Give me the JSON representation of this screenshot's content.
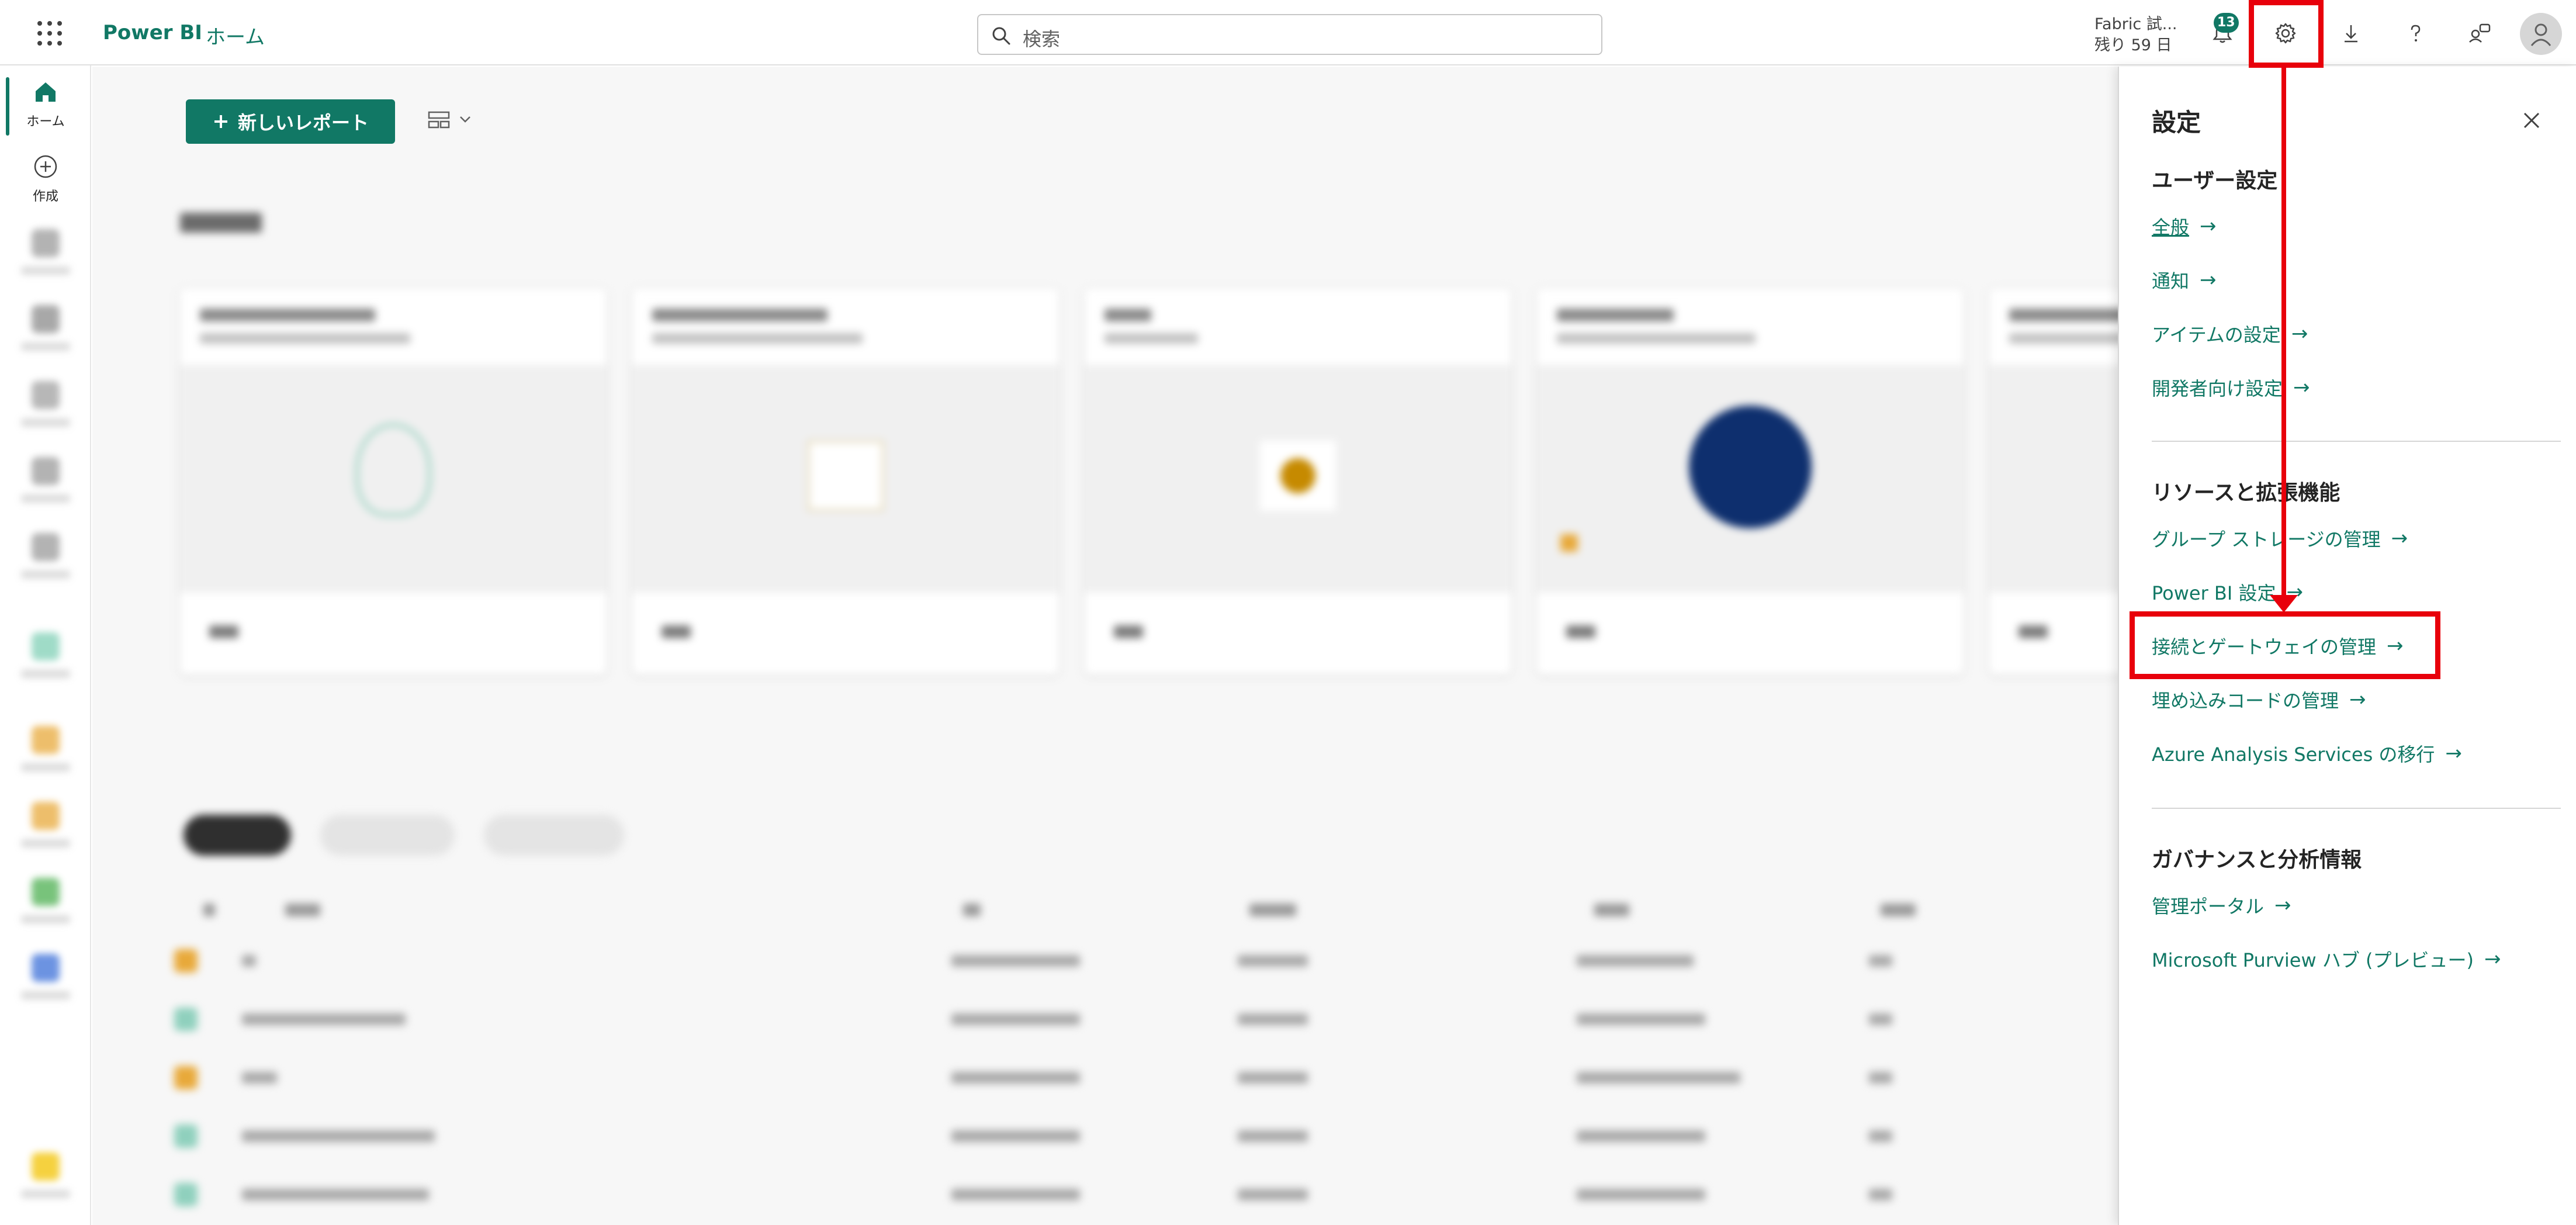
{
  "topbar": {
    "app_name": "Power BI",
    "breadcrumb": "ホーム",
    "search_placeholder": "検索",
    "trial_line1": "Fabric 試...",
    "trial_line2": "残り 59 日",
    "notification_count": "13",
    "icons": [
      "app-launcher-icon",
      "search-icon",
      "bell-icon",
      "gear-icon",
      "download-icon",
      "help-icon",
      "feedback-icon",
      "account-icon"
    ]
  },
  "leftnav": {
    "items": [
      {
        "label": "ホーム",
        "icon": "home-icon"
      },
      {
        "label": "作成",
        "icon": "create-icon"
      }
    ]
  },
  "main": {
    "new_report_label": "新しいレポート"
  },
  "settings_pane": {
    "title": "設定",
    "sections": [
      {
        "heading": "ユーザー設定",
        "links": [
          "全般",
          "通知",
          "アイテムの設定",
          "開発者向け設定"
        ]
      },
      {
        "heading": "リソースと拡張機能",
        "links": [
          "グループ ストレージの管理",
          "Power BI 設定",
          "接続とゲートウェイの管理",
          "埋め込みコードの管理",
          "Azure Analysis Services の移行"
        ]
      },
      {
        "heading": "ガバナンスと分析情報",
        "links": [
          "管理ポータル",
          "Microsoft Purview ハブ (プレビュー)"
        ]
      }
    ]
  },
  "colors": {
    "accent": "#117865",
    "annotation": "#e8000b"
  }
}
